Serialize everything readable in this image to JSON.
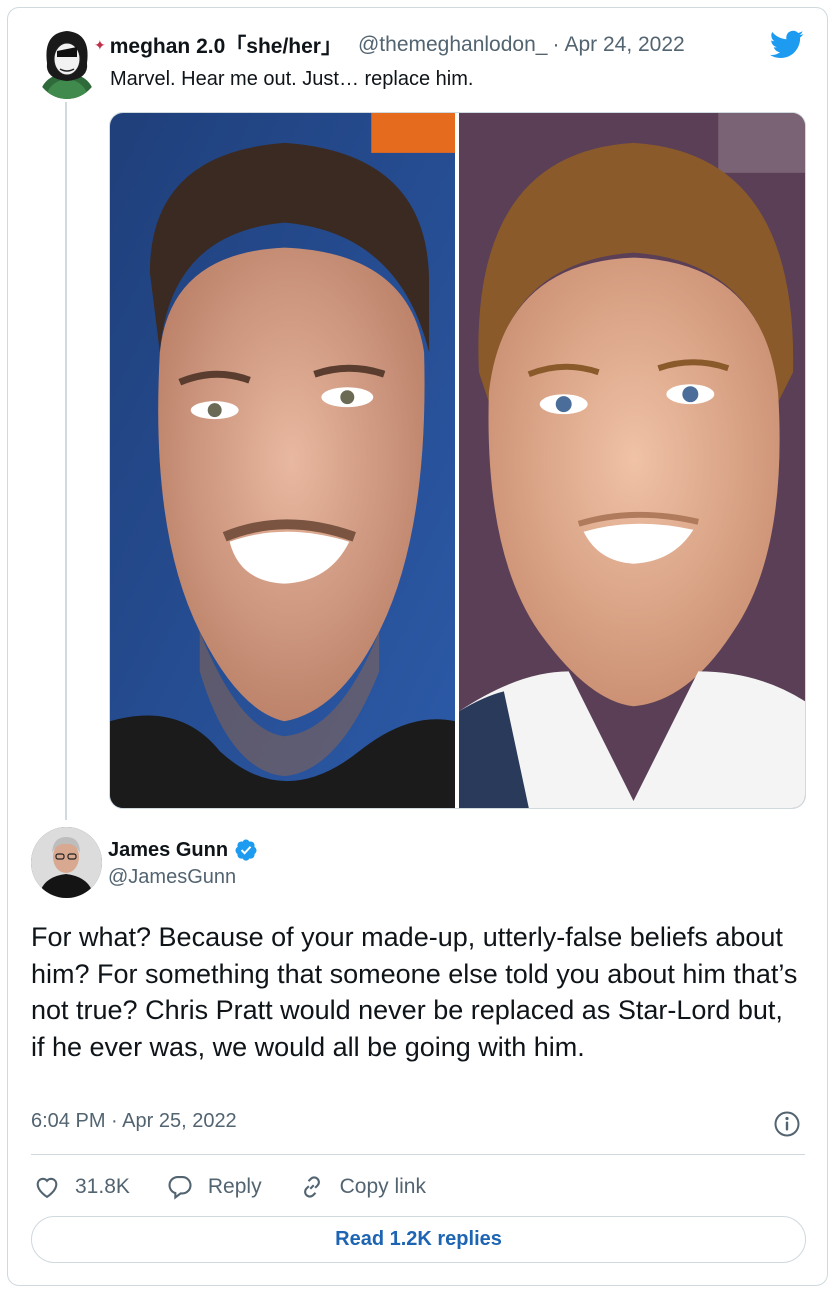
{
  "quoted_tweet": {
    "display_name": "meghan 2.0「she/her」",
    "handle": "@themeghanlodon_",
    "separator": "·",
    "date": "Apr 24, 2022",
    "text": "Marvel. Hear me out. Just… replace him."
  },
  "tweet": {
    "display_name": "James Gunn",
    "handle": "@JamesGunn",
    "text": "For what? Because of your made-up, utterly-false beliefs about him? For something that someone else told you about him that’s not true? Chris Pratt would never be replaced as Star-Lord but, if he ever was, we would all be going with him.",
    "timestamp": "6:04 PM · Apr 25, 2022"
  },
  "actions": {
    "like_count": "31.8K",
    "reply_label": "Reply",
    "copy_link_label": "Copy link"
  },
  "read_replies_label": "Read 1.2K replies",
  "icons": [
    "twitter-bird-icon",
    "verified-badge-icon",
    "info-icon",
    "heart-icon",
    "reply-bubble-icon",
    "link-icon"
  ],
  "colors": {
    "brand_blue": "#1d9bf0",
    "link_blue": "#1d65b3",
    "muted_text": "#536471",
    "border": "#cfd9de"
  }
}
